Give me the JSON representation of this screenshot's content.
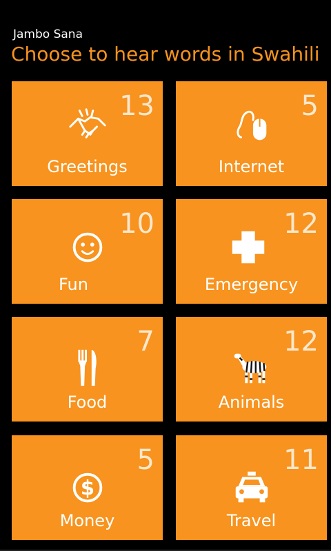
{
  "app": {
    "name": "Jambo Sana",
    "subtitle": "Choose to hear words in Swahili"
  },
  "tiles": [
    {
      "label": "Greetings",
      "count": "13",
      "icon": "handshake-icon"
    },
    {
      "label": "Internet",
      "count": "5",
      "icon": "mouse-icon"
    },
    {
      "label": "Fun",
      "count": "10",
      "icon": "smiley-icon"
    },
    {
      "label": "Emergency",
      "count": "12",
      "icon": "medical-cross-icon"
    },
    {
      "label": "Food",
      "count": "7",
      "icon": "fork-knife-icon"
    },
    {
      "label": "Animals",
      "count": "12",
      "icon": "zebra-icon"
    },
    {
      "label": "Money",
      "count": "5",
      "icon": "dollar-coin-icon"
    },
    {
      "label": "Travel",
      "count": "11",
      "icon": "taxi-icon"
    }
  ],
  "colors": {
    "accent": "#F7931E",
    "background": "#000000",
    "text": "#FFFFFF"
  }
}
